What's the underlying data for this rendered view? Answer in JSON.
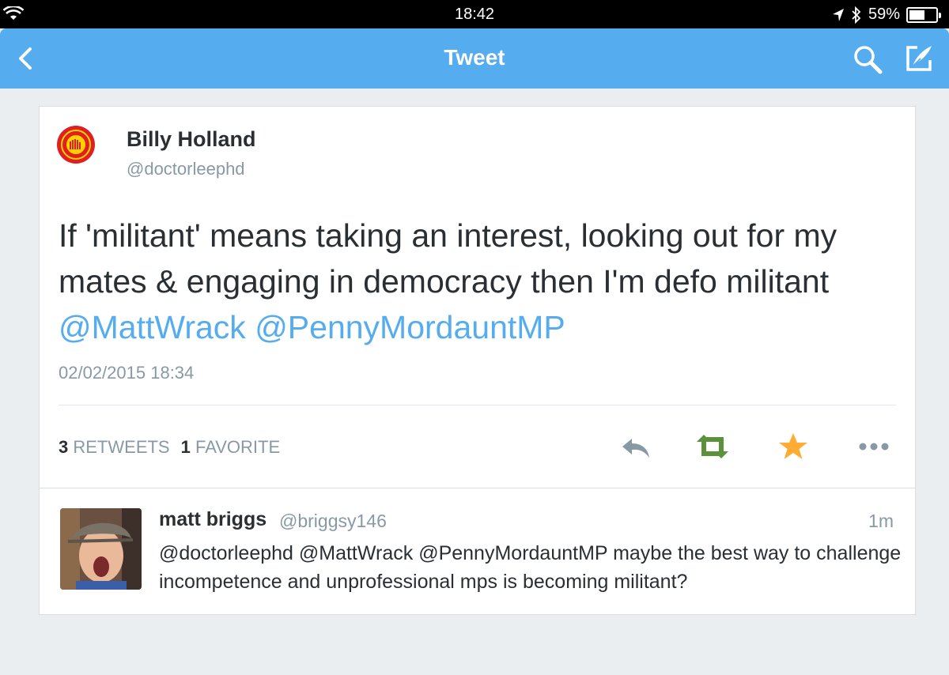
{
  "status_bar": {
    "time": "18:42",
    "battery_text": "59%",
    "battery_level": 0.59,
    "icons": [
      "wifi-icon",
      "location-arrow-icon",
      "bluetooth-icon",
      "battery-icon"
    ]
  },
  "nav": {
    "title": "Tweet",
    "icons": [
      "back-chevron-icon",
      "search-icon",
      "compose-icon"
    ],
    "color": "#55acee"
  },
  "tweet": {
    "author_name": "Billy Holland",
    "author_handle": "@doctorleephd",
    "text": "If 'militant' means taking an interest, looking out for my mates & engaging in democracy then I'm defo militant",
    "mentions": [
      "@MattWrack",
      "@PennyMordauntMP"
    ],
    "timestamp": "02/02/2015 18:34",
    "retweet_count": "3",
    "retweets_label": "RETWEETS",
    "favorite_count": "1",
    "favorite_label": "FAVORITE",
    "actions": [
      "reply-icon",
      "retweet-icon",
      "favorite-star-icon",
      "more-icon"
    ]
  },
  "reply": {
    "author_name": "matt briggs",
    "author_handle": "@briggsy146",
    "time": "1m",
    "text": "@doctorleephd @MattWrack @PennyMordauntMP maybe the best way to challenge incompetence and unprofessional mps is becoming militant?"
  },
  "colors": {
    "accent": "#55acee",
    "retweet": "#5c913b",
    "favorite": "#ffac33",
    "muted": "#8899a6",
    "text": "#292f33"
  }
}
